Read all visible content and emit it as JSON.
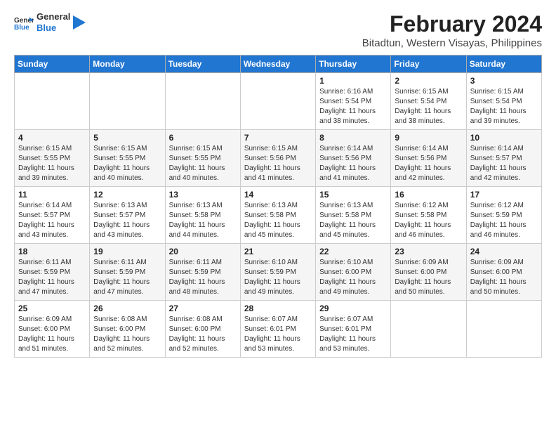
{
  "logo": {
    "general": "General",
    "blue": "Blue"
  },
  "title": "February 2024",
  "subtitle": "Bitadtun, Western Visayas, Philippines",
  "days_of_week": [
    "Sunday",
    "Monday",
    "Tuesday",
    "Wednesday",
    "Thursday",
    "Friday",
    "Saturday"
  ],
  "weeks": [
    [
      {
        "day": "",
        "info": ""
      },
      {
        "day": "",
        "info": ""
      },
      {
        "day": "",
        "info": ""
      },
      {
        "day": "",
        "info": ""
      },
      {
        "day": "1",
        "info": "Sunrise: 6:16 AM\nSunset: 5:54 PM\nDaylight: 11 hours and 38 minutes."
      },
      {
        "day": "2",
        "info": "Sunrise: 6:15 AM\nSunset: 5:54 PM\nDaylight: 11 hours and 38 minutes."
      },
      {
        "day": "3",
        "info": "Sunrise: 6:15 AM\nSunset: 5:54 PM\nDaylight: 11 hours and 39 minutes."
      }
    ],
    [
      {
        "day": "4",
        "info": "Sunrise: 6:15 AM\nSunset: 5:55 PM\nDaylight: 11 hours and 39 minutes."
      },
      {
        "day": "5",
        "info": "Sunrise: 6:15 AM\nSunset: 5:55 PM\nDaylight: 11 hours and 40 minutes."
      },
      {
        "day": "6",
        "info": "Sunrise: 6:15 AM\nSunset: 5:55 PM\nDaylight: 11 hours and 40 minutes."
      },
      {
        "day": "7",
        "info": "Sunrise: 6:15 AM\nSunset: 5:56 PM\nDaylight: 11 hours and 41 minutes."
      },
      {
        "day": "8",
        "info": "Sunrise: 6:14 AM\nSunset: 5:56 PM\nDaylight: 11 hours and 41 minutes."
      },
      {
        "day": "9",
        "info": "Sunrise: 6:14 AM\nSunset: 5:56 PM\nDaylight: 11 hours and 42 minutes."
      },
      {
        "day": "10",
        "info": "Sunrise: 6:14 AM\nSunset: 5:57 PM\nDaylight: 11 hours and 42 minutes."
      }
    ],
    [
      {
        "day": "11",
        "info": "Sunrise: 6:14 AM\nSunset: 5:57 PM\nDaylight: 11 hours and 43 minutes."
      },
      {
        "day": "12",
        "info": "Sunrise: 6:13 AM\nSunset: 5:57 PM\nDaylight: 11 hours and 43 minutes."
      },
      {
        "day": "13",
        "info": "Sunrise: 6:13 AM\nSunset: 5:58 PM\nDaylight: 11 hours and 44 minutes."
      },
      {
        "day": "14",
        "info": "Sunrise: 6:13 AM\nSunset: 5:58 PM\nDaylight: 11 hours and 45 minutes."
      },
      {
        "day": "15",
        "info": "Sunrise: 6:13 AM\nSunset: 5:58 PM\nDaylight: 11 hours and 45 minutes."
      },
      {
        "day": "16",
        "info": "Sunrise: 6:12 AM\nSunset: 5:58 PM\nDaylight: 11 hours and 46 minutes."
      },
      {
        "day": "17",
        "info": "Sunrise: 6:12 AM\nSunset: 5:59 PM\nDaylight: 11 hours and 46 minutes."
      }
    ],
    [
      {
        "day": "18",
        "info": "Sunrise: 6:11 AM\nSunset: 5:59 PM\nDaylight: 11 hours and 47 minutes."
      },
      {
        "day": "19",
        "info": "Sunrise: 6:11 AM\nSunset: 5:59 PM\nDaylight: 11 hours and 47 minutes."
      },
      {
        "day": "20",
        "info": "Sunrise: 6:11 AM\nSunset: 5:59 PM\nDaylight: 11 hours and 48 minutes."
      },
      {
        "day": "21",
        "info": "Sunrise: 6:10 AM\nSunset: 5:59 PM\nDaylight: 11 hours and 49 minutes."
      },
      {
        "day": "22",
        "info": "Sunrise: 6:10 AM\nSunset: 6:00 PM\nDaylight: 11 hours and 49 minutes."
      },
      {
        "day": "23",
        "info": "Sunrise: 6:09 AM\nSunset: 6:00 PM\nDaylight: 11 hours and 50 minutes."
      },
      {
        "day": "24",
        "info": "Sunrise: 6:09 AM\nSunset: 6:00 PM\nDaylight: 11 hours and 50 minutes."
      }
    ],
    [
      {
        "day": "25",
        "info": "Sunrise: 6:09 AM\nSunset: 6:00 PM\nDaylight: 11 hours and 51 minutes."
      },
      {
        "day": "26",
        "info": "Sunrise: 6:08 AM\nSunset: 6:00 PM\nDaylight: 11 hours and 52 minutes."
      },
      {
        "day": "27",
        "info": "Sunrise: 6:08 AM\nSunset: 6:00 PM\nDaylight: 11 hours and 52 minutes."
      },
      {
        "day": "28",
        "info": "Sunrise: 6:07 AM\nSunset: 6:01 PM\nDaylight: 11 hours and 53 minutes."
      },
      {
        "day": "29",
        "info": "Sunrise: 6:07 AM\nSunset: 6:01 PM\nDaylight: 11 hours and 53 minutes."
      },
      {
        "day": "",
        "info": ""
      },
      {
        "day": "",
        "info": ""
      }
    ]
  ]
}
